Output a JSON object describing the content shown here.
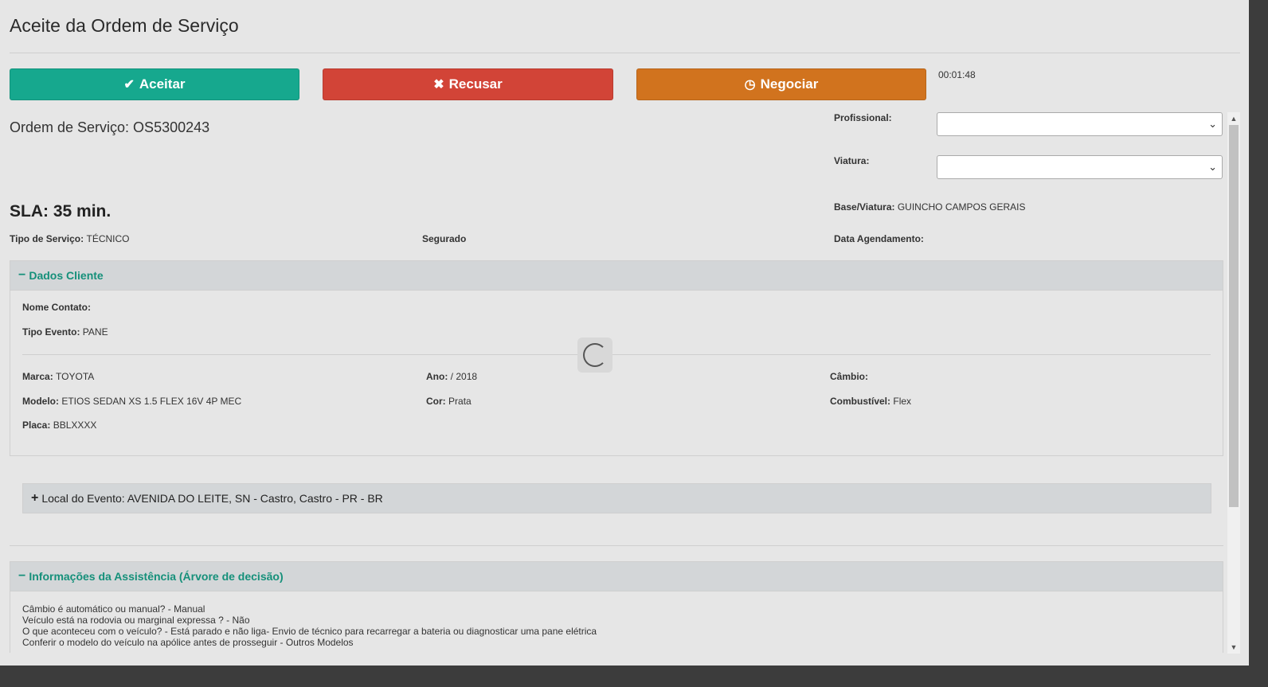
{
  "header": {
    "title": "Aceite da Ordem de Serviço"
  },
  "actions": {
    "accept_label": "Aceitar",
    "refuse_label": "Recusar",
    "negotiate_label": "Negociar",
    "accept_icon": "check-icon",
    "refuse_icon": "close-icon",
    "negotiate_icon": "clock-icon",
    "accept_color": "#16a88e",
    "refuse_color": "#d24437",
    "negotiate_color": "#d1731e"
  },
  "timer": "00:01:48",
  "order": {
    "number_label": "Ordem de Serviço: OS5300243",
    "sla": "SLA: 35 min."
  },
  "assignment": {
    "profissional_label": "Profissional:",
    "profissional_value": "",
    "viatura_label": "Viatura:",
    "viatura_value": "",
    "base_label": "Base/Viatura:",
    "base_value": "GUINCHO CAMPOS GERAIS",
    "data_agendamento_label": "Data Agendamento:"
  },
  "service": {
    "tipo_label": "Tipo de Serviço:",
    "tipo_value": "TÉCNICO",
    "segurado_label": "Segurado"
  },
  "dados_cliente": {
    "title": "Dados Cliente",
    "nome_contato_label": "Nome Contato:",
    "tipo_evento_label": "Tipo Evento:",
    "tipo_evento_value": "PANE",
    "marca_label": "Marca:",
    "marca_value": "TOYOTA",
    "ano_label": "Ano:",
    "ano_value": "/ 2018",
    "cambio_label": "Câmbio:",
    "modelo_label": "Modelo:",
    "modelo_value": "ETIOS SEDAN XS 1.5 FLEX 16V 4P MEC",
    "cor_label": "Cor:",
    "cor_value": "Prata",
    "combustivel_label": "Combustível:",
    "combustivel_value": "Flex",
    "placa_label": "Placa:",
    "placa_value": "BBLXXXX"
  },
  "local_evento": {
    "label": "Local do Evento: AVENIDA DO LEITE, SN - Castro, Castro - PR - BR"
  },
  "assistencia": {
    "title": "Informações da Assistência (Árvore de decisão)",
    "lines": [
      "Câmbio é automático ou manual? - Manual",
      "Veículo está na rodovia ou marginal expressa ? - Não",
      "O que aconteceu com o veículo? - Está parado e não liga- Envio de técnico para recarregar a bateria ou diagnosticar uma pane elétrica",
      "Conferir o modelo do veículo na apólice antes de prosseguir - Outros Modelos"
    ]
  }
}
